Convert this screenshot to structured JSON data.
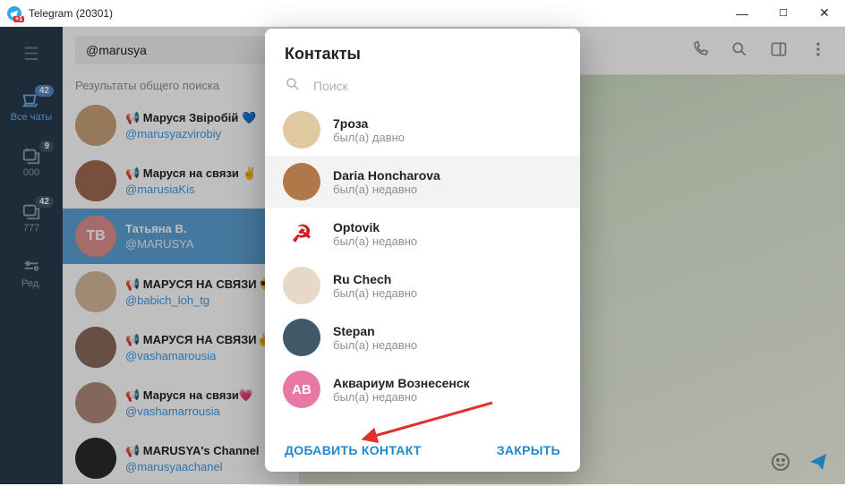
{
  "window": {
    "title": "Telegram (20301)"
  },
  "rail": {
    "tabs": [
      {
        "label": "Все чаты",
        "badge": "42"
      },
      {
        "label": "000",
        "badge": "9"
      },
      {
        "label": "777",
        "badge": "42"
      },
      {
        "label": "Ред.",
        "badge": ""
      }
    ]
  },
  "search": {
    "value": "@marusya"
  },
  "results_label": "Результаты общего поиска",
  "chats": [
    {
      "name": "📢 Маруся Звіробій 💙",
      "username": "@marusyazvirobiy",
      "avcolor": "#c9a07a"
    },
    {
      "name": "📢 Маруся на связи ✌️",
      "username": "@marusiaKis",
      "avcolor": "#a06850"
    },
    {
      "name": "Татьяна В.",
      "username": "@MARUSYA",
      "avcolor": "#e08f8f",
      "initials": "ТВ",
      "selected": true
    },
    {
      "name": "📢 МАРУСЯ НА СВЯЗИ 😎",
      "username": "@babich_loh_tg",
      "avcolor": "#d4b89a"
    },
    {
      "name": "📢 МАРУСЯ НА СВЯЗИ✌️",
      "username": "@vashamarousia",
      "avcolor": "#8a6a5a"
    },
    {
      "name": "📢 Маруся на связи💗",
      "username": "@vashamarrousia",
      "avcolor": "#b08a7a"
    },
    {
      "name": "📢 MARUSYA's Channel",
      "username": "@marusyaachanel",
      "avcolor": "#2a2a2a"
    }
  ],
  "modal": {
    "title": "Контакты",
    "search_placeholder": "Поиск",
    "contacts": [
      {
        "name": "7роза",
        "status": "был(а) давно",
        "avcolor": "#e0c8a0"
      },
      {
        "name": "Daria Honcharova",
        "status": "был(а) недавно",
        "avcolor": "#b07848",
        "hover": true
      },
      {
        "name": "Optovik",
        "status": "был(а) недавно",
        "avcolor": "#d02020",
        "emoji": "☭"
      },
      {
        "name": "Ru Chech",
        "status": "был(а) недавно",
        "avcolor": "#e8d8c8"
      },
      {
        "name": "Stepan",
        "status": "был(а) недавно",
        "avcolor": "#405868"
      },
      {
        "name": "Аквариум Вознесенск",
        "status": "был(а) недавно",
        "avcolor": "#e879a6",
        "initials": "АВ"
      }
    ],
    "add_button": "ДОБАВИТЬ КОНТАКТ",
    "close_button": "ЗАКРЫТЬ"
  }
}
